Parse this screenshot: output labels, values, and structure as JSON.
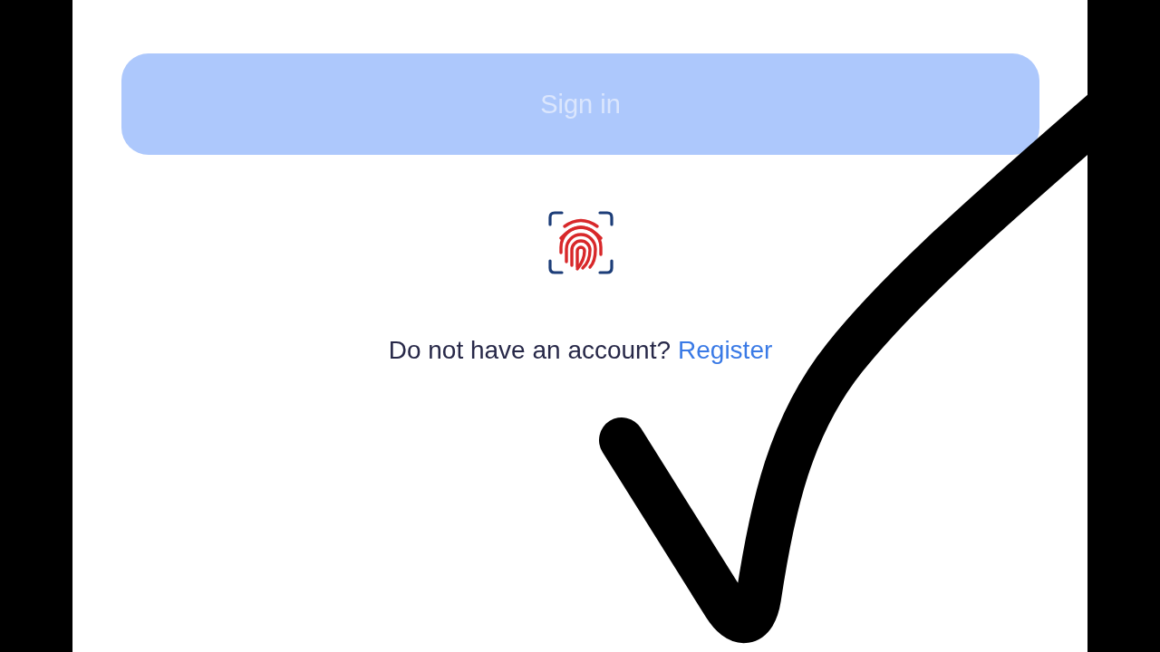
{
  "sign_in_button": {
    "label": "Sign in",
    "disabled": true
  },
  "register_prompt": {
    "text": "Do not have an account?",
    "link": "Register"
  }
}
